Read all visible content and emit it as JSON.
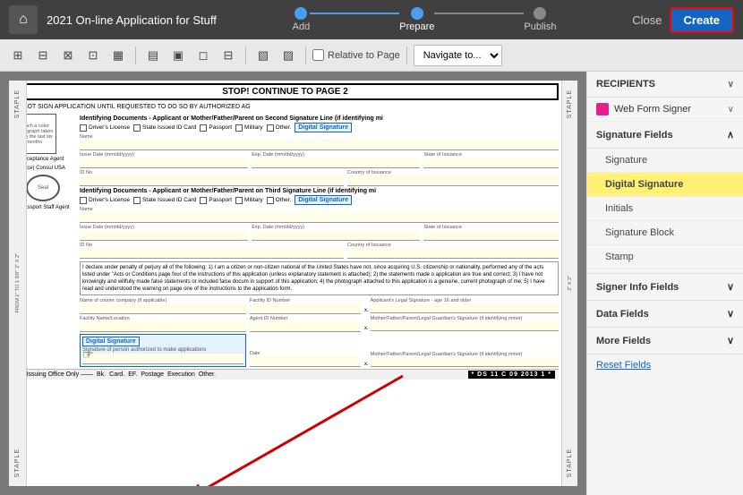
{
  "topbar": {
    "app_title": "2021 On-line Application for Stuff",
    "home_icon": "home",
    "steps": [
      {
        "label": "Add",
        "state": "completed"
      },
      {
        "label": "Prepare",
        "state": "active"
      },
      {
        "label": "Publish",
        "state": "inactive"
      }
    ],
    "close_label": "Close",
    "create_label": "Create"
  },
  "toolbar": {
    "icons": [
      "⊞",
      "⊟",
      "⊠",
      "⊡",
      "▦",
      "▧",
      "▤",
      "▣",
      "◻"
    ],
    "checkbox_label": "Relative to Page",
    "navigate_placeholder": "Navigate to...",
    "navigate_options": [
      "Navigate to..."
    ]
  },
  "document": {
    "stop_banner": "STOP! CONTINUE TO PAGE 2",
    "warning_text": "DO NOT SIGN APPLICATION UNTIL REQUESTED TO DO SO BY AUTHORIZED AG",
    "section1_title": "Identifying Documents - Applicant or Mother/Father/Parent on Second Signature Line (if identifying mi",
    "id_options": [
      "Driver's License",
      "State Issued ID Card",
      "Passport",
      "Military",
      "Other",
      "Digital Signature"
    ],
    "fields": {
      "name_label": "Name",
      "issue_date_label": "Issue Date (mm/dd/yyyy)",
      "exp_date_label": "Exp. Date (mm/dd/yyyy)",
      "state_label": "State of Issuance",
      "id_no_label": "ID No",
      "country_label": "Country of Issuance"
    },
    "section2_title": "Identifying Documents - Applicant or Mother/Father/Parent on Third Signature Line (if identifying mi",
    "declaration_text": "I declare under penalty of perjury all of the following: 1) I am a citizen or non-citizen national of the United States have not, since acquiring U.S. citizenship or nationality, performed any of the acts listed under \"Acts or Conditions page four of the instructions of this application (unless explanatory statement is attached); 2) the statements made o application are true and correct; 3) I have not knowingly and willfully made false statements or included false docum in support of this application; 4) the photograph attached to this application is a genuine, current photograph of me; 5) I have read and understood the warning on page one of the instructions to the application form.",
    "facility_label": "Name of courier company (if applicable)",
    "facility_id_label": "Facility ID Number",
    "legal_sig_label": "Applicant's Legal Signature - age 16 and older",
    "facility_name_label": "Facility Name/Location",
    "agent_id_label": "Agent ID Number",
    "guardian_sig1_label": "Mother/Father/Parent/Legal Guardian's Signature (if identifying minor)",
    "guardian_sig2_label": "Mother/Father/Parent/Legal Guardian's Signature (if identifying minor)",
    "digital_sig_label": "Digital Signature",
    "sig_person_label": "Signature of person authorized to make applications",
    "date_label": "Date",
    "bottom_labels": [
      "For Issuing Office Only",
      "Bk.",
      "Card.",
      "EF.",
      "Postage",
      "Execution",
      "Other."
    ],
    "barcode_text": "* DS 11 C 09 2013 1 *",
    "photo_label": "Attach a color photograph taken within the last six months",
    "staple_texts": [
      "STAPLE",
      "STAPLE"
    ],
    "staple_side_texts": [
      "2\" X 2\"",
      "2\" X 2\"",
      "FROM 1\" TO 1 3/8\""
    ],
    "acceptance_options": [
      "Acceptance Agent",
      "(Vice) Consul USA",
      "Passport Staff Agent"
    ],
    "seal_label": "Seal"
  },
  "right_panel": {
    "recipients_label": "RECIPIENTS",
    "recipient_name": "Web Form Signer",
    "signature_fields_label": "Signature Fields",
    "sig_fields": [
      {
        "label": "Signature",
        "active": false
      },
      {
        "label": "Digital Signature",
        "active": true
      },
      {
        "label": "Initials",
        "active": false
      },
      {
        "label": "Signature Block",
        "active": false
      },
      {
        "label": "Stamp",
        "active": false
      }
    ],
    "signer_info_label": "Signer Info Fields",
    "data_fields_label": "Data Fields",
    "more_fields_label": "More Fields",
    "reset_link": "Reset Fields"
  }
}
